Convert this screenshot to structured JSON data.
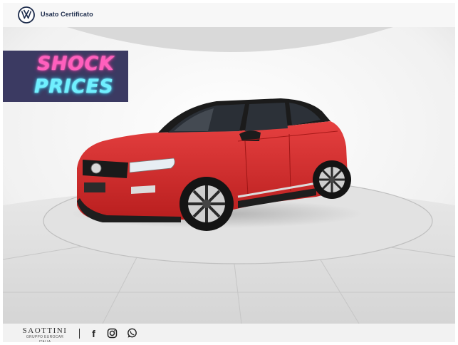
{
  "header": {
    "logo_icon": "vw-logo-icon",
    "title": "Usato Certificato"
  },
  "promo": {
    "line1": "SHOCK",
    "line2": "PRICES",
    "colors": {
      "background": "#3b3a62",
      "line1": "#ff5fbd",
      "line2": "#6ff0ff"
    }
  },
  "car": {
    "body_color": "#d42a2a",
    "roof_color": "#1a1a1a"
  },
  "footer": {
    "dealer_name": "SAOTTINI",
    "dealer_sub": "GRUPPO EUROCAR ITALIA",
    "social_icons": [
      "facebook-icon",
      "instagram-icon",
      "whatsapp-icon"
    ]
  }
}
